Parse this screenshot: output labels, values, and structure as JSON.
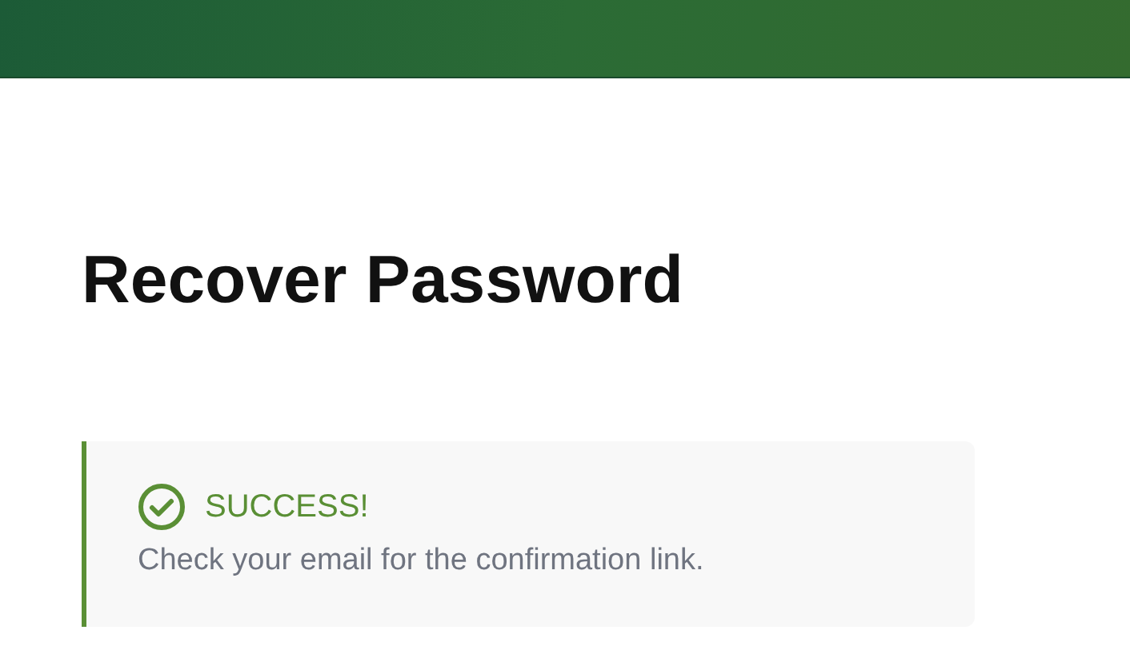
{
  "title": "Recover Password",
  "alert": {
    "kind": "success",
    "heading": "SUCCESS!",
    "message": "Check your email for the confirmation link."
  }
}
